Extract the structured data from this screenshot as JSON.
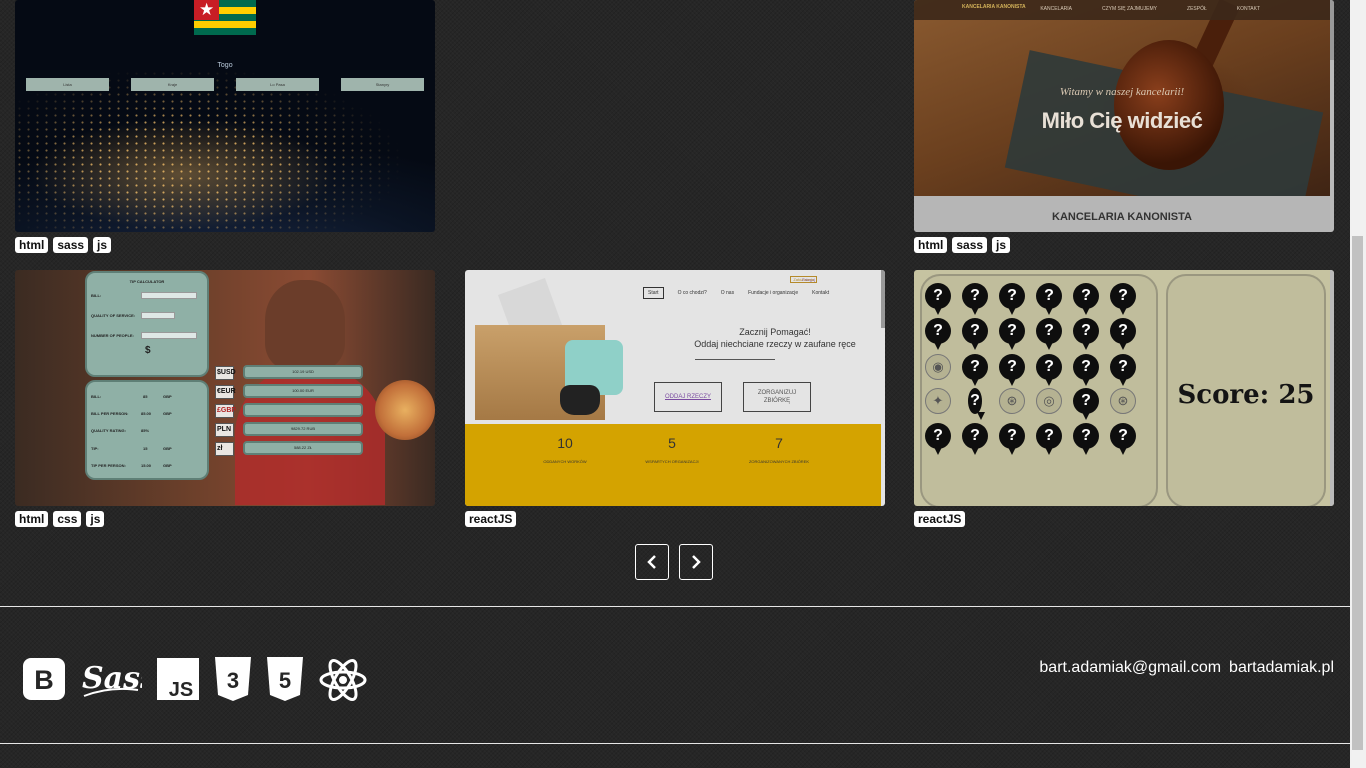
{
  "projects": [
    {
      "id": "world",
      "tags": [
        "html",
        "sass",
        "js"
      ],
      "preview": {
        "country": "Togo",
        "buttons": [
          "Lista",
          "Kraje",
          "Lo Pasa",
          "Stanyry"
        ]
      }
    },
    {
      "id": "kancelaria",
      "tags": [
        "html",
        "sass",
        "js"
      ],
      "preview": {
        "brand": "KANCELARIA KANONISTA",
        "nav": [
          "KANCELARIA",
          "CZYM SIĘ ZAJMUJEMY",
          "ZESPÓŁ",
          "KONTAKT"
        ],
        "welcome": "Witamy w naszej kancelarii!",
        "headline": "Miło Cię widzieć",
        "footer_title": "KANCELARIA KANONISTA"
      }
    },
    {
      "id": "tipcalc",
      "tags": [
        "html",
        "css",
        "js"
      ],
      "preview": {
        "title": "TIP CALCULATOR",
        "labels": [
          "BILL:",
          "QUALITY OF SERVICE:",
          "NUMBER OF PEOPLE:"
        ],
        "results": [
          "BILL:",
          "BILL PER PERSON:",
          "QUALITY RATING:",
          "TIP:",
          "TIP PER PERSON:"
        ],
        "result_values": [
          "85",
          "85.00",
          "85%",
          "15",
          "15.00"
        ],
        "currency": "GBP",
        "converters": [
          "$USD",
          "€EUR",
          "£GBP",
          "PLN",
          "zł"
        ],
        "conv_values": [
          "102.19 USD",
          "100.00 EUR",
          "",
          "9829.72 RUB",
          "588.22 ZŁ"
        ]
      }
    },
    {
      "id": "charity",
      "tags": [
        "reactJS"
      ],
      "preview": {
        "top_links": [
          "Zaloguj",
          "Załóż konto"
        ],
        "nav": [
          "Start",
          "O co chodzi?",
          "O nas",
          "Fundacje i organizacje",
          "Kontakt"
        ],
        "headline_1": "Zacznij Pomagać!",
        "headline_2": "Oddaj niechciane rzeczy w zaufane ręce",
        "cta": [
          "ODDAJ RZECZY",
          "ZORGANIZUJ ZBIÓRKĘ"
        ],
        "stats": [
          {
            "num": "10",
            "label": "ODDANYCH WORKÓW"
          },
          {
            "num": "5",
            "label": "WSPARTYCH ORGANIZACJI"
          },
          {
            "num": "7",
            "label": "ZORGANIZOWANYCH ZBIÓREK"
          }
        ]
      }
    },
    {
      "id": "memory",
      "tags": [
        "reactJS"
      ],
      "preview": {
        "score": "Score: 25"
      }
    }
  ],
  "pagination": {
    "prev_icon": "chevron-left-icon",
    "next_icon": "chevron-right-icon"
  },
  "footer": {
    "tech": [
      "bootstrap-icon",
      "sass-icon",
      "js-icon",
      "css3-icon",
      "html5-icon",
      "react-icon"
    ],
    "email": "bart.adamiak@gmail.com",
    "site": "bartadamiak.pl"
  }
}
